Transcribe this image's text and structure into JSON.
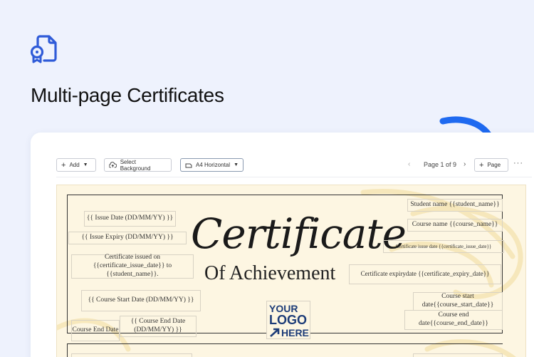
{
  "hero": {
    "title": "Multi-page Certificates",
    "icon": "certificate-document-icon",
    "accent": "#2f5bd8"
  },
  "toolbar": {
    "add_label": "Add",
    "background_label": "Select Background",
    "size_label": "A4 Horizontal",
    "page_indicator": "Page 1 of 9",
    "add_page_label": "Page",
    "more_label": "···"
  },
  "certificate": {
    "title": "Certificate",
    "subtitle": "Of Achievement",
    "logo": {
      "line1": "YOUR",
      "line2": "LOGO",
      "line3": "HERE",
      "color": "#1d3c78"
    },
    "fields": {
      "issue_date": "{{ Issue Date (DD/MM/YY) }}",
      "issue_expiry": "{{ Issue Expiry (DD/MM/YY) }}",
      "issued_on_1": "Certificate issued on",
      "issued_on_2": "{{certificate_issue_date}} to",
      "issued_on_3": "{{student_name}}.",
      "course_start_date": "{{ Course Start Date (DD/MM/YY) }}",
      "course_end_label": "Course End Date",
      "course_end_date_1": "{{ Course End Date",
      "course_end_date_2": "(DD/MM/YY) }}",
      "student_name": "Student name {{student_name}}",
      "course_name": "Course name {{course_name}}",
      "cert_issue_date": "Certificate issue date {{certificate_issue_date}}",
      "cert_expiry": "Certificate expirydate {{certificate_expiry_date}}",
      "course_start_1": "Course start",
      "course_start_2": "date{{course_start_date}}",
      "course_end_1": "Course end",
      "course_end_2": "date{{course_end_date}}"
    }
  }
}
